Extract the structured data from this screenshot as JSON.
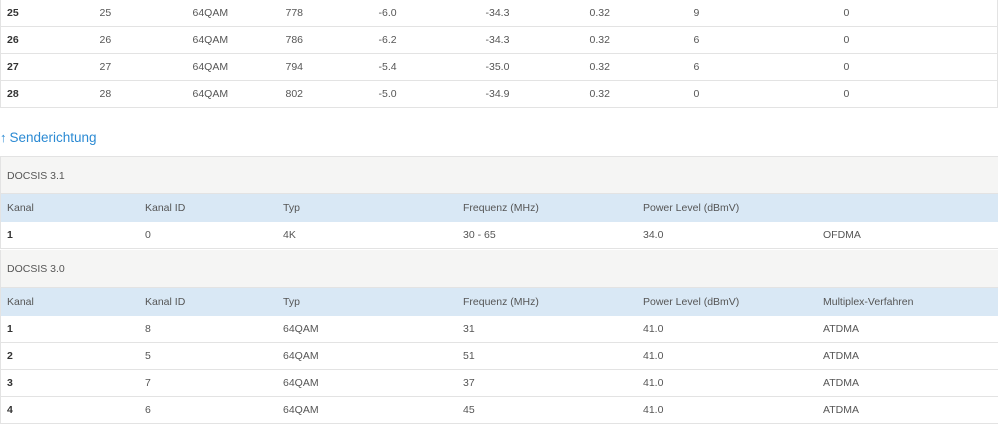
{
  "downstream": {
    "rows": [
      [
        "25",
        "25",
        "64QAM",
        "778",
        "-6.0",
        "-34.3",
        "0.32",
        "9",
        "0"
      ],
      [
        "26",
        "26",
        "64QAM",
        "786",
        "-6.2",
        "-34.3",
        "0.32",
        "6",
        "0"
      ],
      [
        "27",
        "27",
        "64QAM",
        "794",
        "-5.4",
        "-35.0",
        "0.32",
        "6",
        "0"
      ],
      [
        "28",
        "28",
        "64QAM",
        "802",
        "-5.0",
        "-34.9",
        "0.32",
        "0",
        "0"
      ]
    ]
  },
  "upstream": {
    "heading": "Senderichtung",
    "arrow_icon": "arrow-up-icon",
    "docsis31": {
      "title": "DOCSIS 3.1",
      "headers": [
        "Kanal",
        "Kanal ID",
        "Typ",
        "Frequenz (MHz)",
        "Power Level (dBmV)",
        ""
      ],
      "rows": [
        [
          "1",
          "0",
          "4K",
          "30 - 65",
          "34.0",
          "OFDMA"
        ]
      ]
    },
    "docsis30": {
      "title": "DOCSIS 3.0",
      "headers": [
        "Kanal",
        "Kanal ID",
        "Typ",
        "Frequenz (MHz)",
        "Power Level (dBmV)",
        "Multiplex-Verfahren"
      ],
      "rows": [
        [
          "1",
          "8",
          "64QAM",
          "31",
          "41.0",
          "ATDMA"
        ],
        [
          "2",
          "5",
          "64QAM",
          "51",
          "41.0",
          "ATDMA"
        ],
        [
          "3",
          "7",
          "64QAM",
          "37",
          "41.0",
          "ATDMA"
        ],
        [
          "4",
          "6",
          "64QAM",
          "45",
          "41.0",
          "ATDMA"
        ]
      ]
    }
  }
}
